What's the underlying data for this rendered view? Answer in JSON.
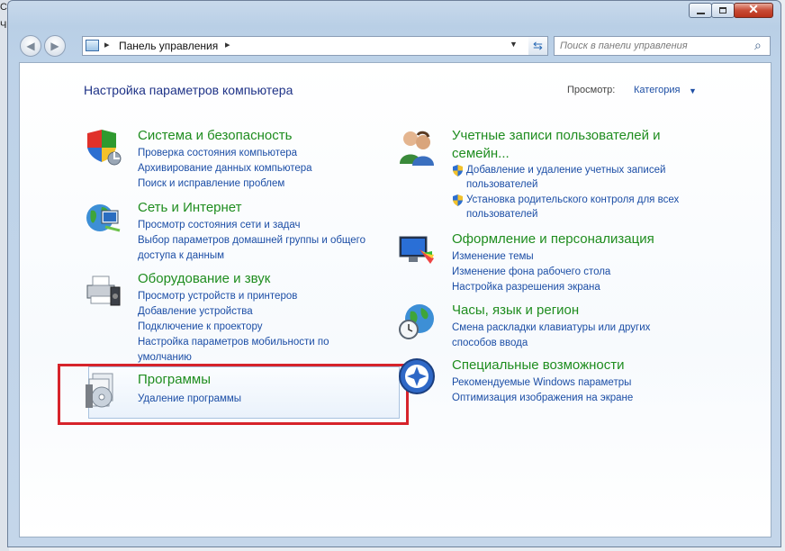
{
  "background": {
    "left_chars": [
      "С",
      "Ч"
    ]
  },
  "navigation": {
    "back_icon": "back-arrow-icon",
    "forward_icon": "forward-arrow-icon"
  },
  "address": {
    "path": "Панель управления"
  },
  "search": {
    "placeholder": "Поиск в панели управления"
  },
  "page": {
    "heading": "Настройка параметров компьютера",
    "view_label": "Просмотр:",
    "view_value": "Категория"
  },
  "left_categories": [
    {
      "title": "Система и безопасность",
      "icon": "shield-icon",
      "links": [
        "Проверка состояния компьютера",
        "Архивирование данных компьютера",
        "Поиск и исправление проблем"
      ]
    },
    {
      "title": "Сеть и Интернет",
      "icon": "globe-network-icon",
      "links": [
        "Просмотр состояния сети и задач",
        "Выбор параметров домашней группы и общего",
        "доступа к данным"
      ]
    },
    {
      "title": "Оборудование и звук",
      "icon": "printer-icon",
      "links": [
        "Просмотр устройств и принтеров",
        "Добавление устройства",
        "Подключение к проектору",
        "Настройка параметров мобильности по",
        "умолчанию"
      ]
    },
    {
      "title": "Программы",
      "icon": "programs-disc-icon",
      "links": [
        "Удаление программы"
      ]
    }
  ],
  "right_categories": [
    {
      "title": "Учетные записи пользователей и",
      "title2": "семейн...",
      "icon": "users-icon",
      "links": [
        "Добавление и удаление учетных записей",
        "пользователей",
        "Установка родительского контроля для всех",
        "пользователей"
      ]
    },
    {
      "title": "Оформление и персонализация",
      "icon": "monitor-paint-icon",
      "links": [
        "Изменение темы",
        "Изменение фона рабочего стола",
        "Настройка разрешения экрана"
      ]
    },
    {
      "title": "Часы, язык и регион",
      "icon": "globe-clock-icon",
      "links": [
        "Смена раскладки клавиатуры или других",
        "способов ввода"
      ]
    },
    {
      "title": "Специальные возможности",
      "icon": "accessibility-icon",
      "links": [
        "Рекомендуемые Windows параметры",
        "Оптимизация изображения на экране"
      ]
    }
  ],
  "colors": {
    "category_title": "#1f8d1f",
    "link": "#1c4ea6",
    "heading": "#1e3287",
    "highlight": "#d6232b"
  }
}
